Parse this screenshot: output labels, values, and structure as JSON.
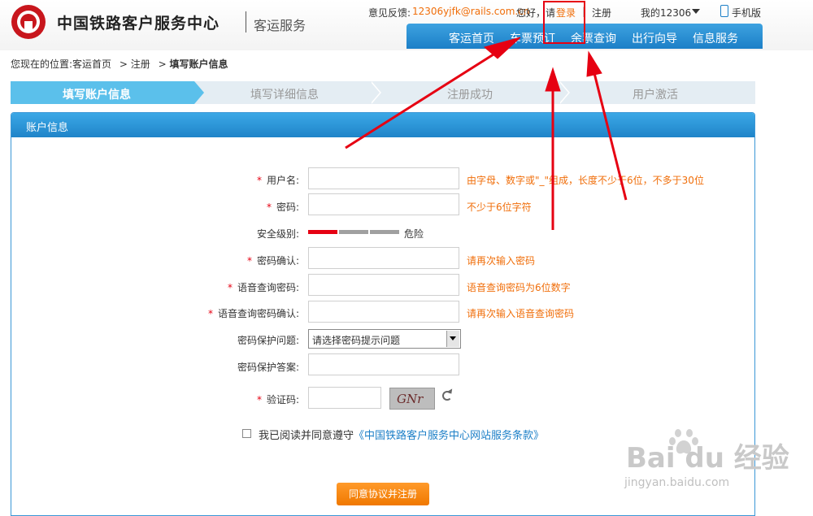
{
  "header": {
    "site_title": "中国铁路客户服务中心",
    "site_subtitle": "客运服务",
    "feedback_label": "意见反馈:",
    "feedback_email": "12306yjfk@rails.com.cn",
    "greeting": "您好，请",
    "login_link": "登录",
    "divider": "|",
    "register_link": "注册",
    "my12306": "我的12306",
    "mobile": "手机版",
    "nav": [
      "客运首页",
      "车票预订",
      "余票查询",
      "出行向导",
      "信息服务"
    ]
  },
  "breadcrumb": {
    "prefix": "您现在的位置:",
    "home": "客运首页",
    "sep1": ">",
    "register": "注册",
    "sep2": ">",
    "current": "填写账户信息"
  },
  "steps": [
    "填写账户信息",
    "填写详细信息",
    "注册成功",
    "用户激活"
  ],
  "panel": {
    "title": "账户信息"
  },
  "form": {
    "required_mark": "*",
    "username_label": "用户名:",
    "username_hint": "由字母、数字或\"_\"组成，长度不少于6位，不多于30位",
    "password_label": "密码:",
    "password_hint": "不少于6位字符",
    "security_label": "安全级别:",
    "security_level": "危险",
    "security_value": 1,
    "security_max": 3,
    "confirm_label": "密码确认:",
    "confirm_hint": "请再次输入密码",
    "voice_label": "语音查询密码:",
    "voice_hint": "语音查询密码为6位数字",
    "voice_confirm_label": "语音查询密码确认:",
    "voice_confirm_hint": "请再次输入语音查询密码",
    "question_label": "密码保护问题:",
    "question_selected": "请选择密码提示问题",
    "answer_label": "密码保护答案:",
    "captcha_label": "验证码:",
    "captcha_text": "GNr",
    "agree_text": "我已阅读并同意遵守",
    "agree_link": "《中国铁路客户服务中心网站服务条款》",
    "submit_label": "同意协议并注册"
  },
  "watermark": {
    "main": "Bai du 经验",
    "sub": "jingyan.baidu.com"
  },
  "colors": {
    "accent": "#1c7fc7",
    "hint": "#f06e0a",
    "required": "#e60012",
    "step_active": "#5bc0eb",
    "submit": "#f07800"
  }
}
